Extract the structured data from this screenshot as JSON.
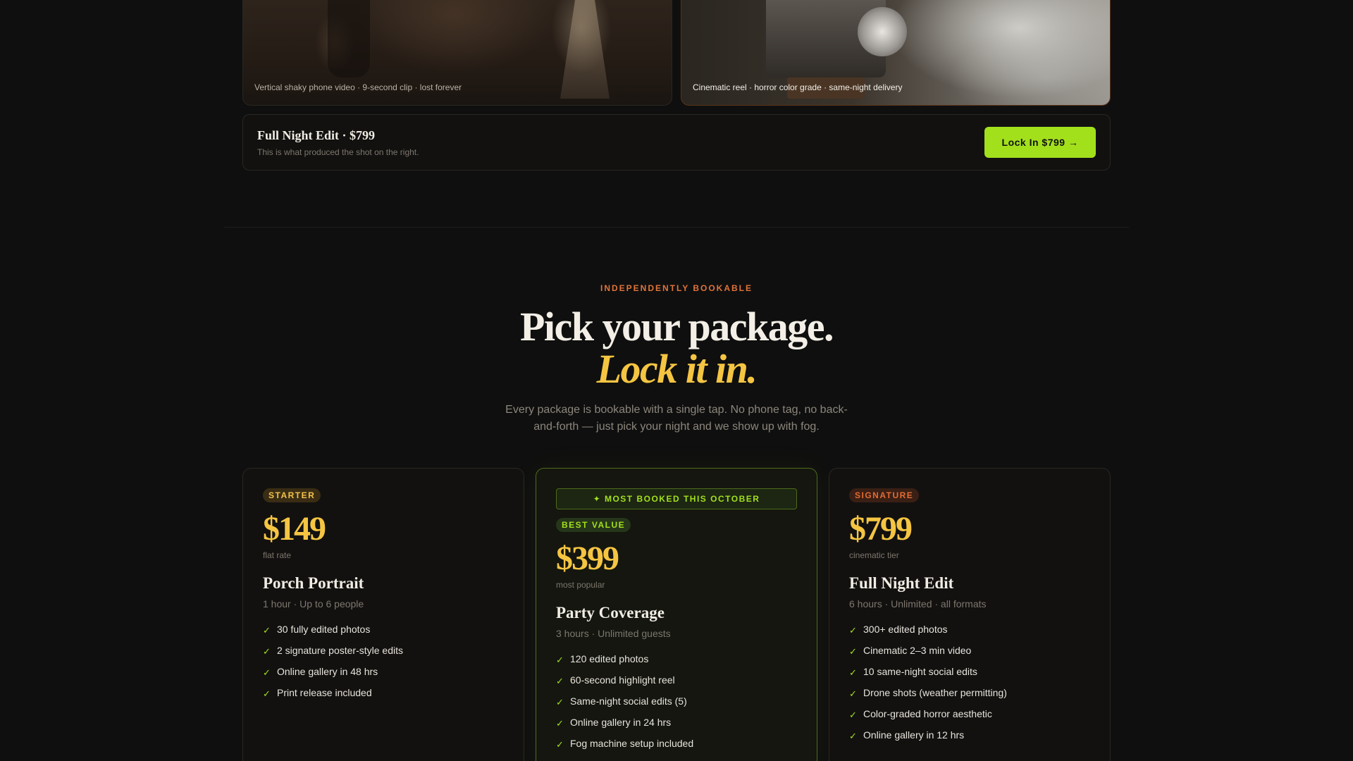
{
  "compare": {
    "left_caption": "Vertical shaky phone video · 9-second clip · lost forever",
    "right_caption": "Cinematic reel · horror color grade · same-night delivery"
  },
  "cta": {
    "title": "Full Night Edit · $799",
    "subtitle": "This is what produced the shot on the right.",
    "button": "Lock In $799 →"
  },
  "section": {
    "eyebrow": "INDEPENDENTLY BOOKABLE",
    "heading": "Pick your package.",
    "heading_accent": "Lock it in.",
    "lede": "Every package is bookable with a single tap. No phone tag, no back-and-forth — just pick your night and we show up with fog."
  },
  "packages": [
    {
      "badge": "STARTER",
      "price": "$149",
      "price_note": "flat rate",
      "name": "Porch Portrait",
      "meta": "1 hour · Up to 6 people",
      "features": [
        "30 fully edited photos",
        "2 signature poster-style edits",
        "Online gallery in 48 hrs",
        "Print release included"
      ]
    },
    {
      "banner": "✦ MOST BOOKED THIS OCTOBER",
      "badge": "BEST VALUE",
      "price": "$399",
      "price_note": "most popular",
      "name": "Party Coverage",
      "meta": "3 hours · Unlimited guests",
      "features": [
        "120 edited photos",
        "60-second highlight reel",
        "Same-night social edits (5)",
        "Online gallery in 24 hrs",
        "Fog machine setup included"
      ]
    },
    {
      "badge": "SIGNATURE",
      "price": "$799",
      "price_note": "cinematic tier",
      "name": "Full Night Edit",
      "meta": "6 hours · Unlimited · all formats",
      "features": [
        "300+ edited photos",
        "Cinematic 2–3 min video",
        "10 same-night social edits",
        "Drone shots (weather permitting)",
        "Color-graded horror aesthetic",
        "Online gallery in 12 hrs"
      ]
    }
  ],
  "check_glyph": "✓"
}
